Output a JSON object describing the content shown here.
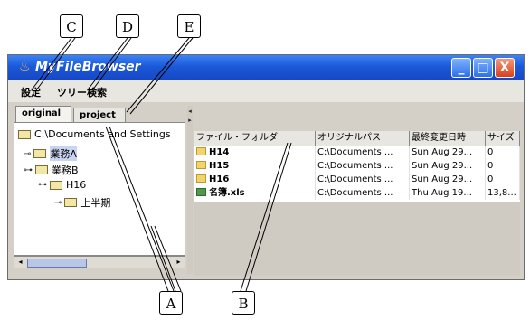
{
  "callouts": {
    "A": "A",
    "B": "B",
    "C": "C",
    "D": "D",
    "E": "E"
  },
  "window": {
    "title": "MyFileBrowser",
    "controls": {
      "minimize": "_",
      "maximize": "□",
      "close": "X"
    }
  },
  "menu": {
    "settings": "設定",
    "tree_search": "ツリー検索"
  },
  "tabs": {
    "original": "original",
    "project": "project"
  },
  "tree": {
    "root": "C:\\Documents and Settings",
    "nodes": [
      "業務A",
      "業務B",
      "H16",
      "上半期"
    ]
  },
  "table": {
    "headers": [
      "ファイル・フォルダ",
      "オリジナルパス",
      "最終変更日時",
      "サイズ"
    ],
    "rows": [
      {
        "name": "H14",
        "path": "C:\\Documents ...",
        "modified": "Sun Aug 29...",
        "size": "0",
        "icon": "folder-icon"
      },
      {
        "name": "H15",
        "path": "C:\\Documents ...",
        "modified": "Sun Aug 29...",
        "size": "0",
        "icon": "folder-icon"
      },
      {
        "name": "H16",
        "path": "C:\\Documents ...",
        "modified": "Sun Aug 29...",
        "size": "0",
        "icon": "folder-icon"
      },
      {
        "name": "名簿.xls",
        "path": "C:\\Documents ...",
        "modified": "Thu Aug 19...",
        "size": "13,8...",
        "icon": "excel-file-icon"
      }
    ]
  }
}
